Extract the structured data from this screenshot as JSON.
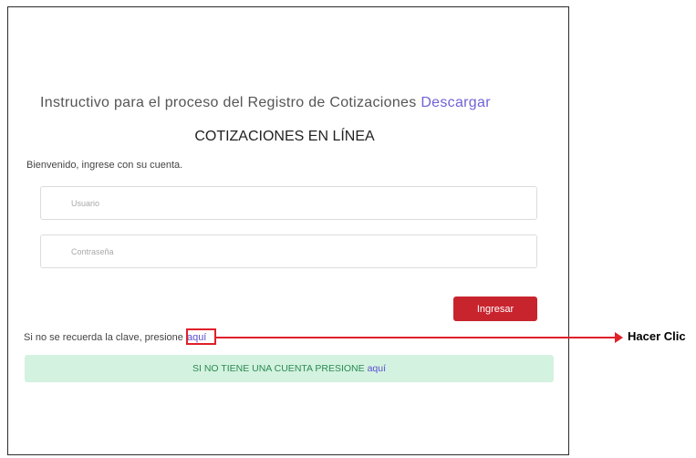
{
  "instructions": {
    "text": "Instructivo para el proceso del Registro de Cotizaciones",
    "download_link": "Descargar"
  },
  "heading": "COTIZACIONES EN LÍNEA",
  "welcome": "Bienvenido, ingrese con su cuenta.",
  "form": {
    "username_placeholder": "Usuario",
    "password_placeholder": "Contraseña",
    "submit_label": "Ingresar"
  },
  "forgot": {
    "text": "Si no se recuerda la clave, presione",
    "link": "aquí"
  },
  "signup": {
    "text": "SI NO TIENE UNA CUENTA PRESIONE",
    "link": "aquí"
  },
  "annotation": {
    "label": "Hacer Clic"
  },
  "colors": {
    "primary_button": "#c8242e",
    "link": "#6f63d6",
    "signup_bg": "#d4f2e0",
    "signup_text": "#2a8a52",
    "annotation": "#e0202a"
  }
}
